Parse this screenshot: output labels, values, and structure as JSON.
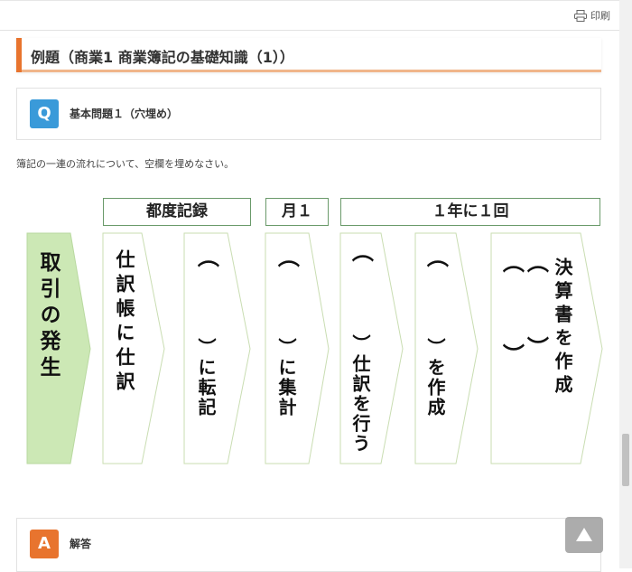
{
  "toolbar": {
    "print_label": "印刷",
    "print_icon": "printer-icon"
  },
  "example": {
    "title": "例題（商業1 商業簿記の基礎知識（1））"
  },
  "question": {
    "badge": "Q",
    "label": "基本問題１（穴埋め）"
  },
  "instruction": "簿記の一連の流れについて、空欄を埋めなさい。",
  "diagram": {
    "headers": [
      "都度記録",
      "月１",
      "１年に１回"
    ],
    "steps": [
      {
        "text": "取引の発生"
      },
      {
        "text": "仕訳帳に仕訳"
      },
      {
        "paren": "（",
        "text": "）に転記"
      },
      {
        "paren": "（",
        "text": "）に集計"
      },
      {
        "paren": "（",
        "text": "）仕訳を行う"
      },
      {
        "paren": "（",
        "text": "）を作成"
      },
      {
        "paren1": "（",
        "paren2": "（",
        "close1": "）",
        "close2": "）",
        "text": "決算書を作成"
      }
    ],
    "colors": {
      "first_fill": "#cce8b5",
      "outline": "#c9ddb2",
      "header_border": "#6a9a6a"
    }
  },
  "answer": {
    "badge": "A",
    "label": "解答"
  },
  "colors": {
    "accent": "#e8742e",
    "q_badge": "#3a9ad9",
    "a_badge": "#e8742e"
  }
}
